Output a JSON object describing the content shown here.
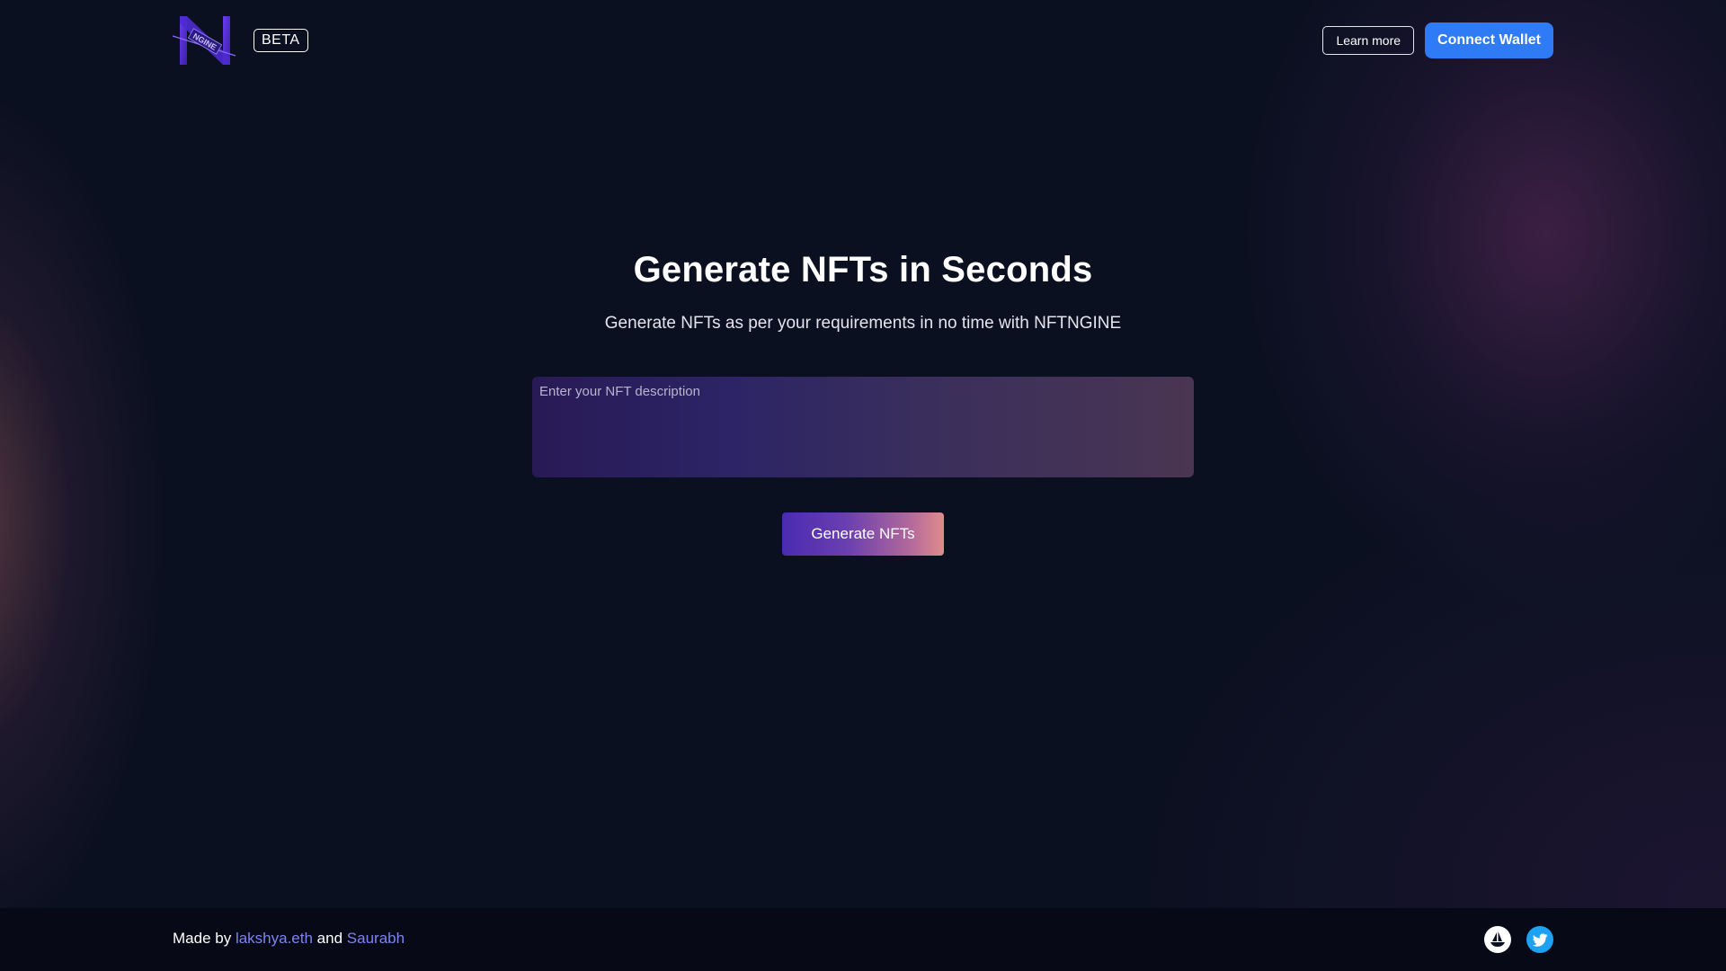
{
  "header": {
    "beta_label": "BETA",
    "learn_more_label": "Learn more",
    "connect_wallet_label": "Connect Wallet"
  },
  "hero": {
    "title": "Generate NFTs in Seconds",
    "subtitle": "Generate NFTs as per your requirements in no time with NFTNGINE"
  },
  "form": {
    "description_placeholder": "Enter your NFT description",
    "description_value": "",
    "generate_label": "Generate NFTs"
  },
  "footer": {
    "made_by_prefix": "Made by",
    "author_one": "lakshya.eth",
    "joiner": "and",
    "author_two": "Saurabh",
    "socials": [
      {
        "icon": "opensea-icon"
      },
      {
        "icon": "twitter-icon"
      }
    ]
  },
  "colors": {
    "background": "#0b1020",
    "accent_blue": "#2f7af5",
    "link": "#7b84f0",
    "twitter": "#1da1f2"
  }
}
